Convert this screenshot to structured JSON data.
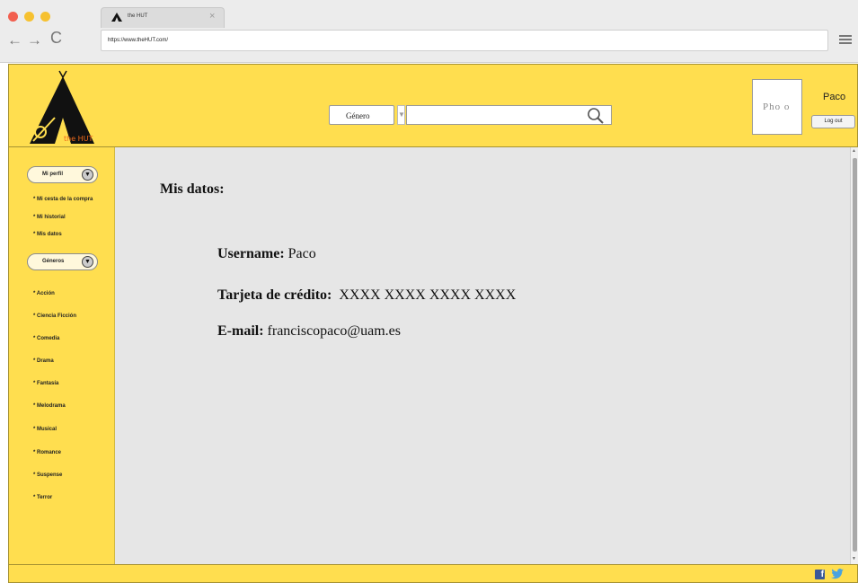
{
  "browser": {
    "tab_title": "the HUT",
    "tab_close": "×",
    "url": "https://www.theHUT.com/",
    "back_glyph": "←",
    "forward_glyph": "→",
    "reload_glyph": "C"
  },
  "header": {
    "logo_text": "the HUT",
    "genre_select": "Género",
    "genre_arrow": "▼",
    "search_value": "",
    "avatar_text": "Pho o",
    "username": "Paco",
    "logout_label": "Log out"
  },
  "sidebar": {
    "profile_dropdown": "Mi perfil",
    "profile_links": [
      "* Mi cesta de la compra",
      "* Mi historial",
      "* Mis datos"
    ],
    "genres_dropdown": "Géneros",
    "genre_links": [
      "* Acción",
      "* Ciencia Ficción",
      "* Comedia",
      "* Drama",
      "* Fantasía",
      "* Melodrama",
      "* Musical",
      "* Romance",
      "* Suspense",
      "* Terror"
    ],
    "dropdown_icon": "▼"
  },
  "main": {
    "title": "Mis datos:",
    "fields": [
      {
        "label": "Username:",
        "value": "Paco"
      },
      {
        "label": "Tarjeta de crédito:",
        "value": "XXXX XXXX XXXX XXXX"
      },
      {
        "label": "E-mail:",
        "value": "franciscopaco@uam.es"
      }
    ]
  },
  "footer": {
    "facebook": "f",
    "icons": [
      "facebook-icon",
      "twitter-icon"
    ]
  },
  "colors": {
    "brand_yellow": "#ffde4f",
    "content_gray": "#e6e6e6",
    "facebook_blue": "#3b5998",
    "twitter_blue": "#4aa3df"
  }
}
